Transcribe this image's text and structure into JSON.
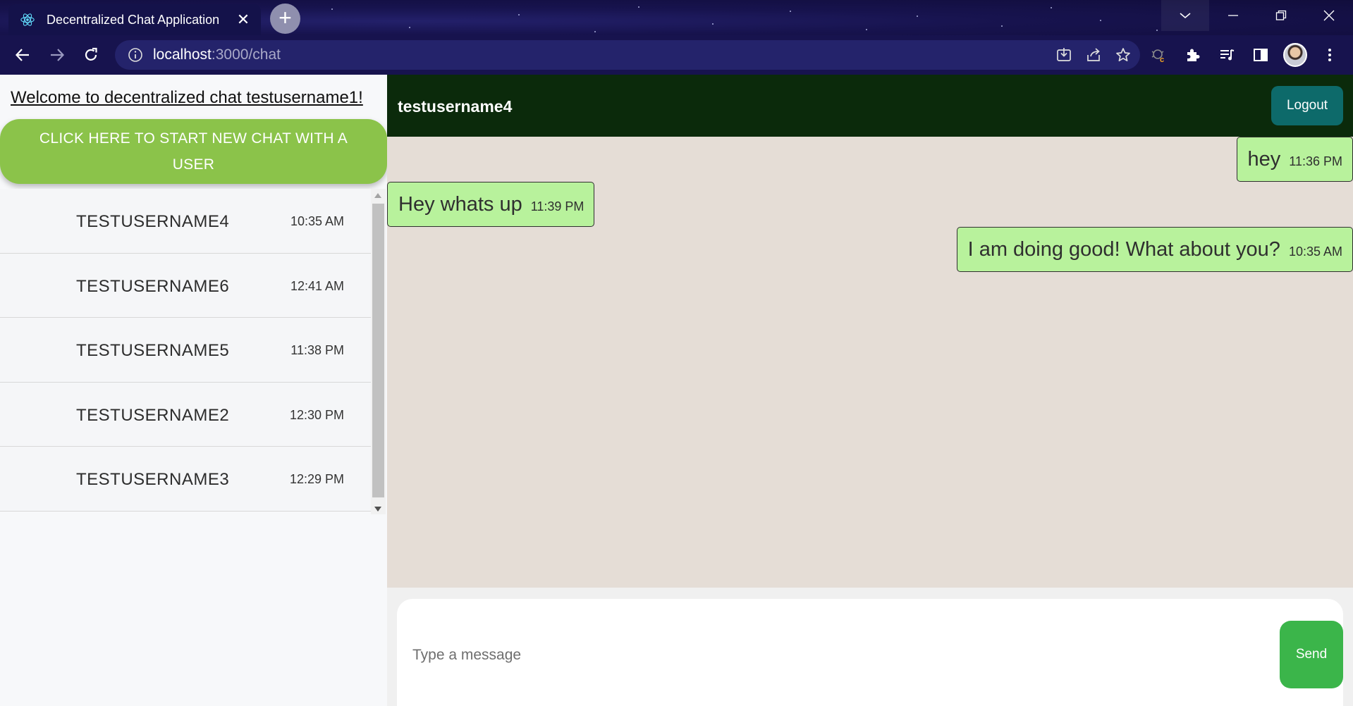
{
  "browser": {
    "tab_title": "Decentralized Chat Application",
    "tab_close": "✕",
    "new_tab": "+",
    "url_host": "localhost",
    "url_path": ":3000/chat"
  },
  "sidebar": {
    "welcome": "Welcome to decentralized chat testusername1!",
    "new_chat_label": "CLICK HERE TO START NEW CHAT WITH A USER",
    "chats": [
      {
        "name": "TESTUSERNAME4",
        "time": "10:35 AM"
      },
      {
        "name": "TESTUSERNAME6",
        "time": "12:41 AM"
      },
      {
        "name": "TESTUSERNAME5",
        "time": "11:38 PM"
      },
      {
        "name": "TESTUSERNAME2",
        "time": "12:30 PM"
      },
      {
        "name": "TESTUSERNAME3",
        "time": "12:29 PM"
      }
    ]
  },
  "chat": {
    "title": "testusername4",
    "logout_label": "Logout",
    "messages": [
      {
        "text": "hey",
        "time": "11:36 PM",
        "side": "right"
      },
      {
        "text": "Hey whats up",
        "time": "11:39 PM",
        "side": "left"
      },
      {
        "text": "I am doing good! What about you?",
        "time": "10:35 AM",
        "side": "right"
      }
    ],
    "input_placeholder": "Type a message",
    "send_label": "Send"
  },
  "colors": {
    "header_bg": "#0b2a0b",
    "bubble_bg": "#b8f29c",
    "new_chat_bg": "#8bc34a",
    "send_bg": "#3bb54a",
    "logout_bg": "#0d6a6a"
  }
}
